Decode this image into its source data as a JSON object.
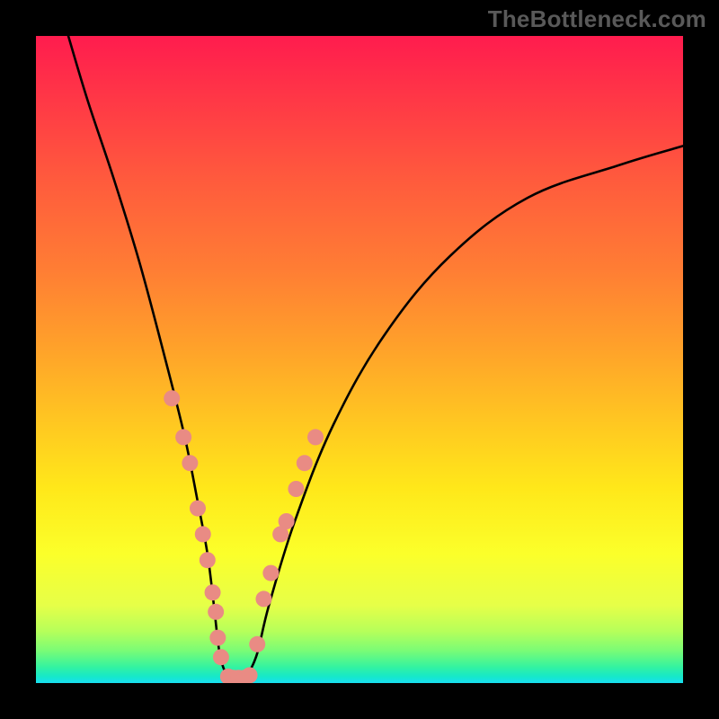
{
  "watermark": "TheBottleneck.com",
  "chart_data": {
    "type": "line",
    "title": "",
    "xlabel": "",
    "ylabel": "",
    "xlim": [
      0,
      100
    ],
    "ylim": [
      0,
      100
    ],
    "grid": false,
    "legend": false,
    "series": [
      {
        "name": "bottleneck-curve",
        "x": [
          5,
          8,
          12,
          16,
          20,
          23,
          25,
          26.5,
          27.5,
          28.5,
          30,
          32,
          34,
          36,
          40,
          46,
          54,
          64,
          76,
          90,
          100
        ],
        "y": [
          100,
          90,
          78,
          65,
          50,
          38,
          28,
          20,
          12,
          4,
          0.8,
          0.8,
          4,
          12,
          25,
          40,
          54,
          66,
          75,
          80,
          83
        ],
        "stroke": "#000",
        "width": 2.6
      }
    ],
    "markers": [
      {
        "name": "highlight-points",
        "color": "#e98b84",
        "radius": 9,
        "points": [
          {
            "x": 21.0,
            "y": 44
          },
          {
            "x": 22.8,
            "y": 38
          },
          {
            "x": 23.8,
            "y": 34
          },
          {
            "x": 25.0,
            "y": 27
          },
          {
            "x": 25.8,
            "y": 23
          },
          {
            "x": 26.5,
            "y": 19
          },
          {
            "x": 27.3,
            "y": 14
          },
          {
            "x": 27.8,
            "y": 11
          },
          {
            "x": 28.1,
            "y": 7
          },
          {
            "x": 28.6,
            "y": 4
          },
          {
            "x": 29.7,
            "y": 1.0
          },
          {
            "x": 30.5,
            "y": 0.8
          },
          {
            "x": 31.3,
            "y": 0.8
          },
          {
            "x": 32.2,
            "y": 0.8
          },
          {
            "x": 33.0,
            "y": 1.2
          },
          {
            "x": 34.2,
            "y": 6
          },
          {
            "x": 35.2,
            "y": 13
          },
          {
            "x": 36.3,
            "y": 17
          },
          {
            "x": 37.8,
            "y": 23
          },
          {
            "x": 38.7,
            "y": 25
          },
          {
            "x": 40.2,
            "y": 30
          },
          {
            "x": 41.5,
            "y": 34
          },
          {
            "x": 43.2,
            "y": 38
          }
        ]
      }
    ],
    "background": {
      "type": "vertical-gradient",
      "stops": [
        {
          "pos": 0,
          "color": "#ff1c4e"
        },
        {
          "pos": 50,
          "color": "#ffc821"
        },
        {
          "pos": 80,
          "color": "#fbff2a"
        },
        {
          "pos": 100,
          "color": "#18dff2"
        }
      ]
    }
  }
}
